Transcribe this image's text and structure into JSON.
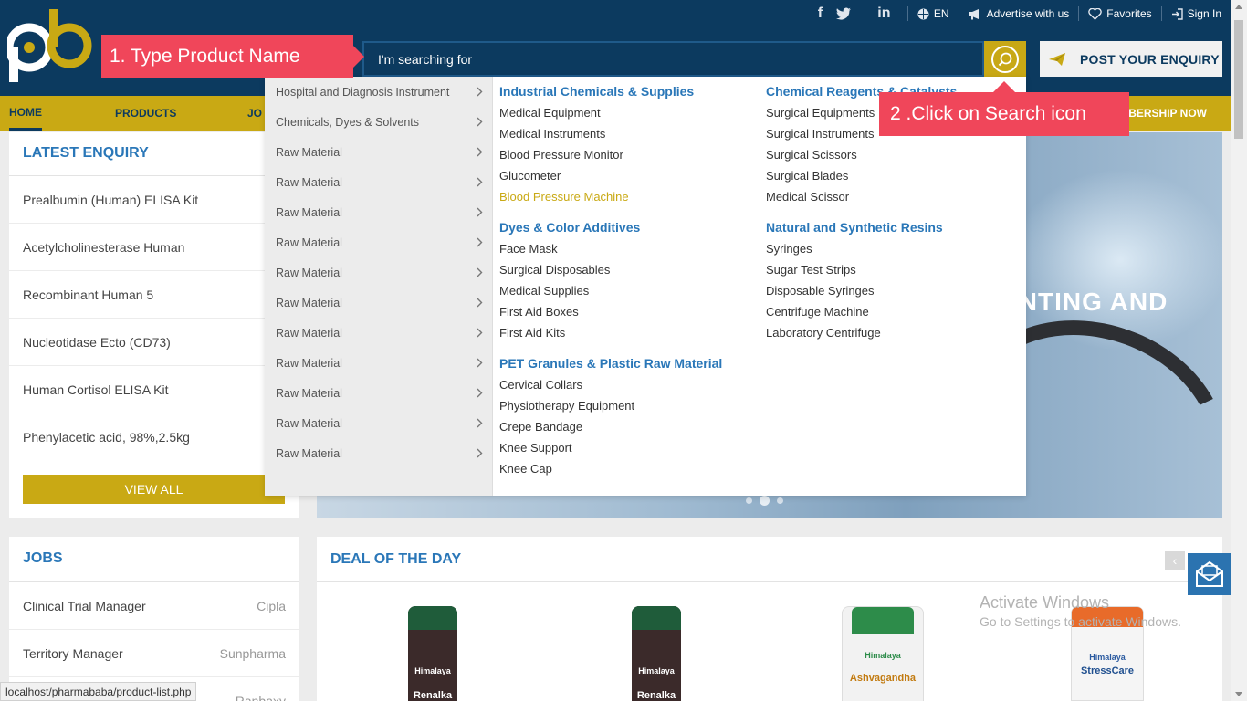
{
  "header": {
    "brand_initials": "pb",
    "brand_letter": "P",
    "social": [
      "f",
      "t",
      "in"
    ],
    "language": "EN",
    "advertise": "Advertise with us",
    "favorites": "Favorites",
    "signin": "Sign In",
    "search_placeholder": "I'm searching for",
    "post_enquiry": "POST YOUR ENQUIRY"
  },
  "callouts": {
    "step1": "1. Type Product Name",
    "step2": "2 .Click on Search icon"
  },
  "nav": {
    "items": [
      "HOME",
      "PRODUCTS",
      "JO"
    ],
    "membership": "BERSHIP NOW"
  },
  "latest_enquiry": {
    "title": "LATEST ENQUIRY",
    "items": [
      "Prealbumin (Human) ELISA Kit",
      "Acetylcholinesterase Human",
      "Recombinant Human 5",
      "Nucleotidase Ecto (CD73)",
      "Human Cortisol ELISA Kit",
      "Phenylacetic acid, 98%,2.5kg"
    ],
    "view_all": "VIEW ALL"
  },
  "jobs": {
    "title": "JOBS",
    "rows": [
      {
        "role": "Clinical Trial Manager",
        "company": "Cipla"
      },
      {
        "role": "Territory Manager",
        "company": "Sunpharma"
      },
      {
        "role": "",
        "company": "Ranbaxy"
      }
    ]
  },
  "banner": {
    "headline": "INTING AND"
  },
  "deal": {
    "title": "DEAL OF THE DAY",
    "prev": "‹",
    "products": [
      {
        "brand": "Himalaya",
        "name": "Renalka"
      },
      {
        "brand": "Himalaya",
        "name": "Renalka"
      },
      {
        "brand": "Himalaya",
        "name": "Ashvagandha"
      },
      {
        "brand": "Himalaya",
        "name": "StressCare"
      }
    ]
  },
  "activate": {
    "line1": "Activate Windows",
    "line2": "Go to Settings to activate Windows."
  },
  "mega_menu": {
    "categories": [
      "Hospital and Diagnosis Instrument",
      "Chemicals, Dyes & Solvents",
      "Raw Material",
      "Raw Material",
      "Raw Material",
      "Raw Material",
      "Raw Material",
      "Raw Material",
      "Raw Material",
      "Raw Material",
      "Raw Material",
      "Raw Material",
      "Raw Material"
    ],
    "col1": [
      {
        "heading": "Industrial Chemicals & Supplies",
        "items": [
          "Medical Equipment",
          "Medical Instruments",
          "Blood Pressure Monitor",
          "Glucometer",
          "Blood Pressure Machine"
        ]
      },
      {
        "heading": "Dyes & Color Additives",
        "items": [
          "Face Mask",
          "Surgical Disposables",
          "Medical Supplies",
          "First Aid Boxes",
          "First Aid Kits"
        ]
      },
      {
        "heading": "PET Granules & Plastic Raw Material",
        "items": [
          "Cervical Collars",
          "Physiotherapy Equipment",
          "Crepe Bandage",
          "Knee Support",
          "Knee Cap"
        ]
      }
    ],
    "col2": [
      {
        "heading": "Chemical Reagents & Catalysts",
        "items": [
          "Surgical Equipments",
          "Surgical Instruments",
          "Surgical Scissors",
          "Surgical Blades",
          "Medical Scissor"
        ]
      },
      {
        "heading": "Natural and Synthetic Resins",
        "items": [
          "Syringes",
          "Sugar Test Strips",
          "Disposable Syringes",
          "Centrifuge Machine",
          "Laboratory Centrifuge"
        ]
      }
    ],
    "highlight": "Blood Pressure Machine"
  },
  "status_url": "localhost/pharmababa/product-list.php",
  "colors": {
    "header_bg": "#0c3a5f",
    "accent_gold": "#c9a914",
    "link_blue": "#2a77b8",
    "callout_red": "#f0465a"
  }
}
